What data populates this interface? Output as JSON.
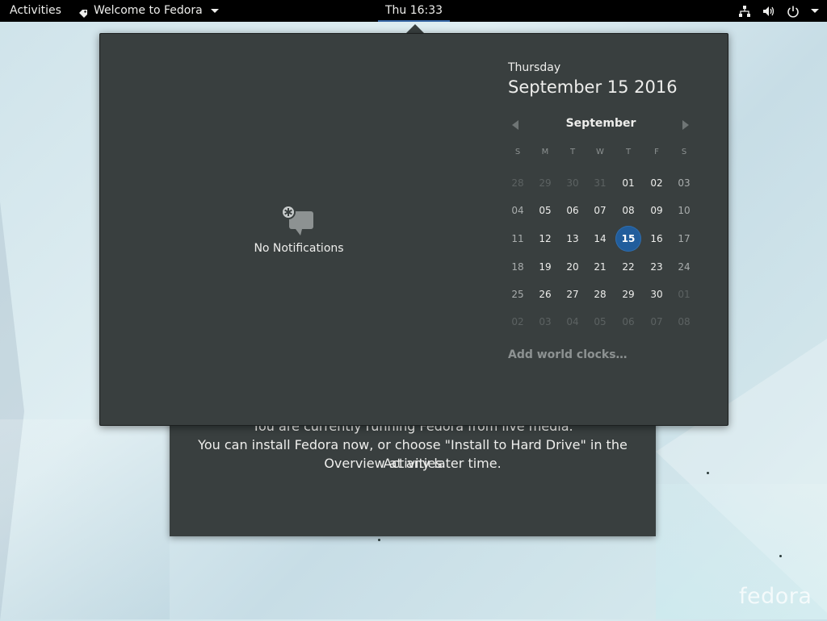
{
  "topbar": {
    "activities": "Activities",
    "app_menu": "Welcome to Fedora",
    "clock": "Thu 16:33"
  },
  "welcome": {
    "line1": "You are currently running Fedora from live media.",
    "line2": "You can install Fedora now, or choose \"Install to Hard Drive\" in the Activities",
    "line3": "Overview at any later time."
  },
  "notifications": {
    "empty_label": "No Notifications"
  },
  "calendar": {
    "day_name": "Thursday",
    "full_date": "September 15 2016",
    "month": "September",
    "weekdays": [
      "S",
      "M",
      "T",
      "W",
      "T",
      "F",
      "S"
    ],
    "weeks": [
      [
        "28",
        "29",
        "30",
        "31",
        "01",
        "02",
        "03"
      ],
      [
        "04",
        "05",
        "06",
        "07",
        "08",
        "09",
        "10"
      ],
      [
        "11",
        "12",
        "13",
        "14",
        "15",
        "16",
        "17"
      ],
      [
        "18",
        "19",
        "20",
        "21",
        "22",
        "23",
        "24"
      ],
      [
        "25",
        "26",
        "27",
        "28",
        "29",
        "30",
        "01"
      ],
      [
        "02",
        "03",
        "04",
        "05",
        "06",
        "07",
        "08"
      ]
    ],
    "today": "15",
    "add_world_clocks": "Add world clocks…"
  },
  "desktop": {
    "logo_text": "fedora"
  },
  "colors": {
    "accent": "#215d9c",
    "panel_bg": "#393f3f",
    "topbar_bg": "#000000"
  }
}
